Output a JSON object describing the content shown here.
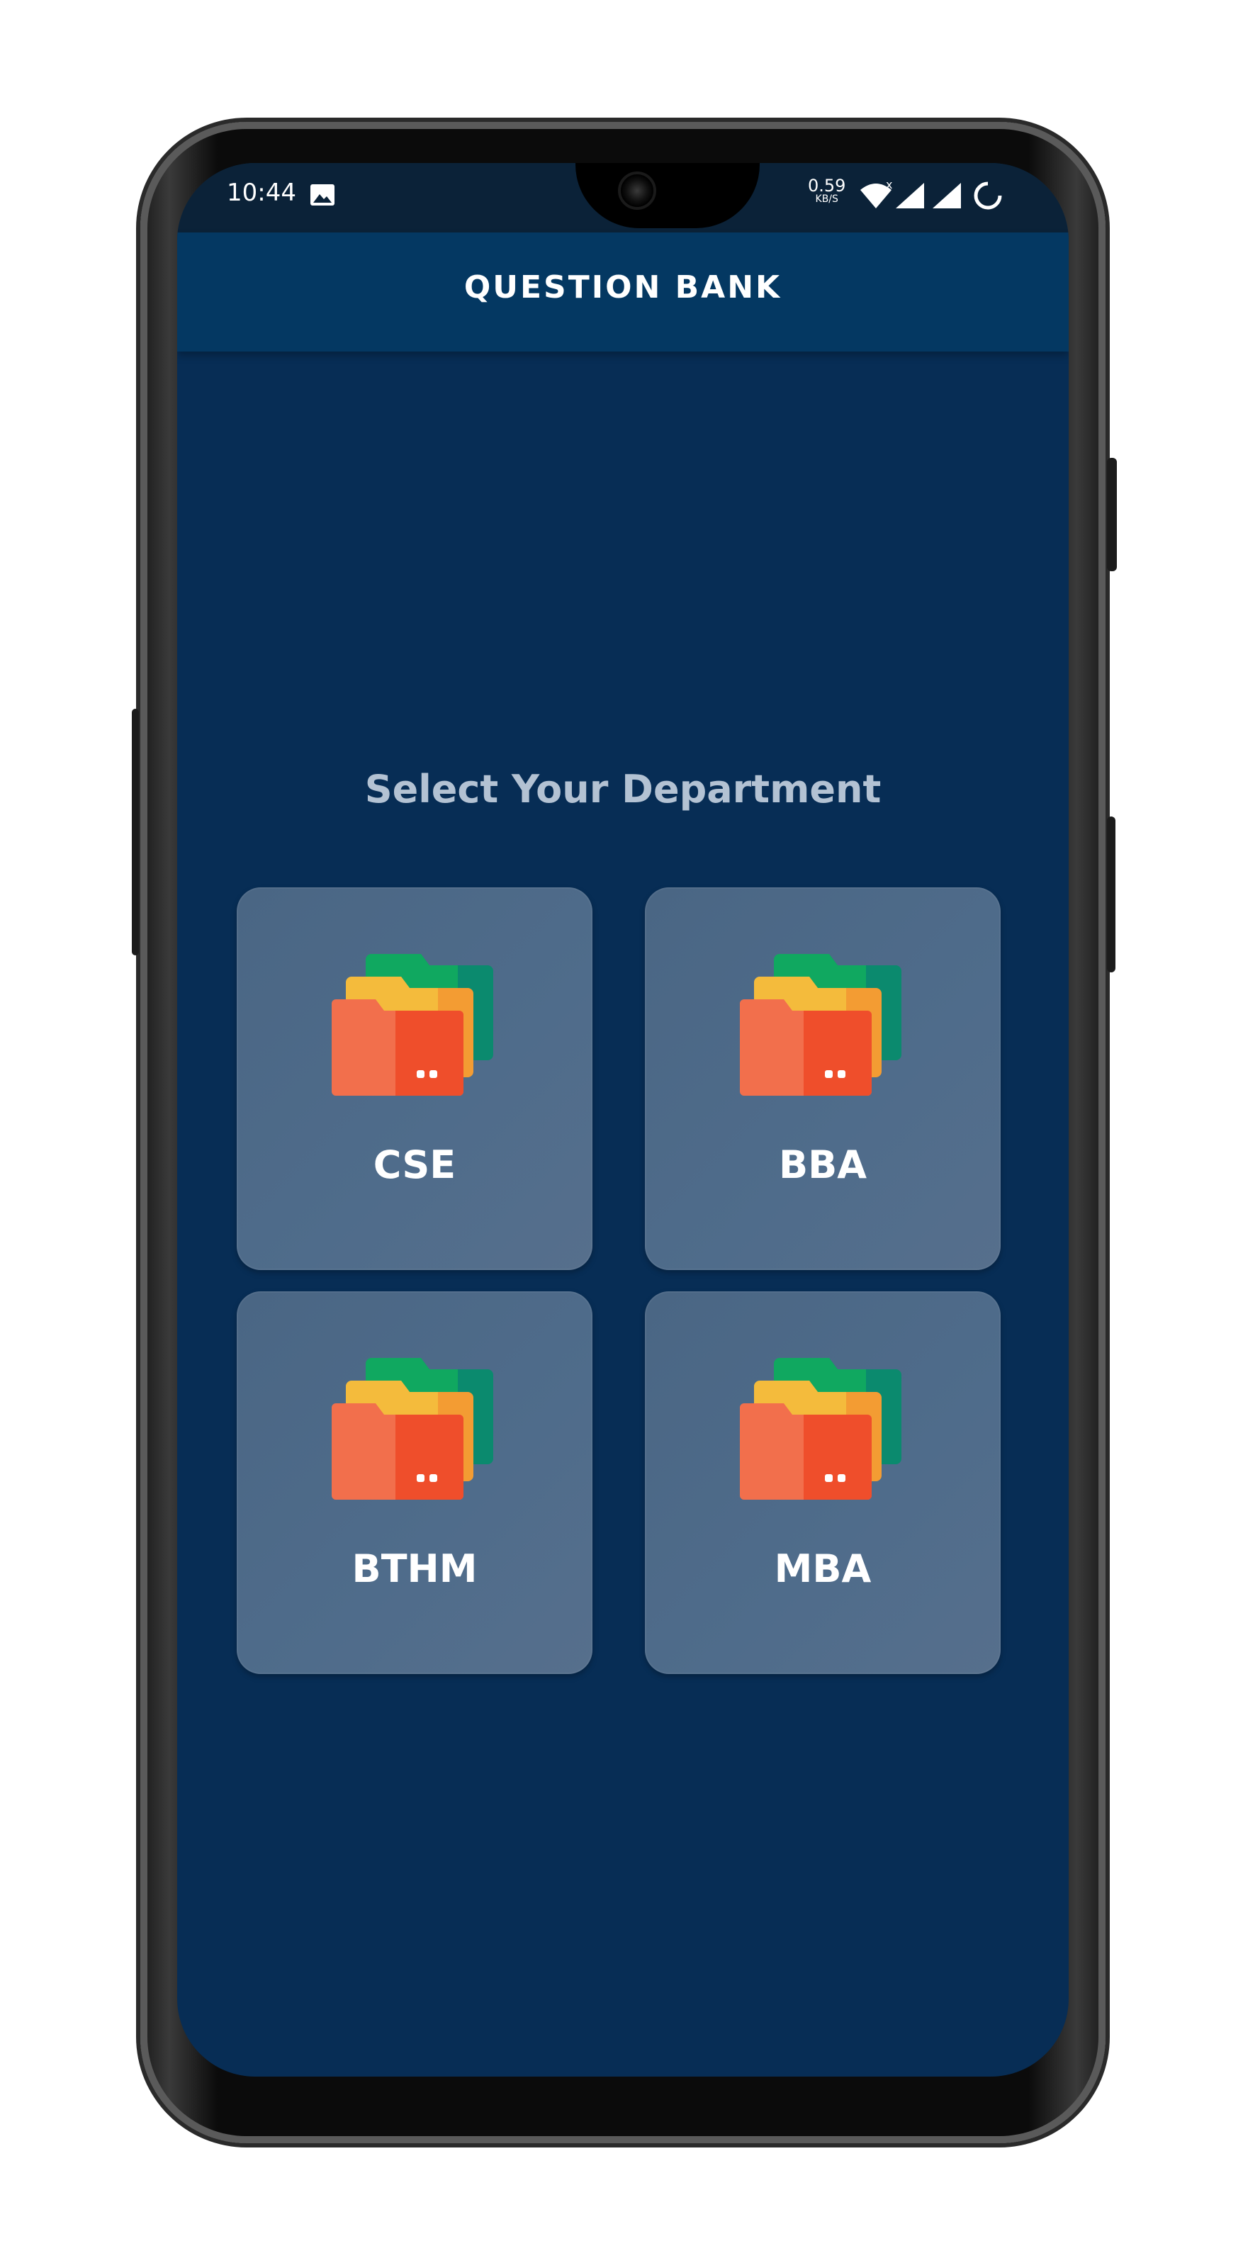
{
  "status_bar": {
    "time": "10:44",
    "speed_value": "0.59",
    "speed_unit": "KB/S",
    "icons": [
      "gallery-icon",
      "wifi-icon",
      "signal-icon",
      "signal-icon",
      "loading-ring-icon"
    ]
  },
  "app_bar": {
    "title": "QUESTION BANK"
  },
  "main": {
    "heading": "Select Your Department",
    "departments": [
      {
        "label": "CSE",
        "icon": "folders-icon"
      },
      {
        "label": "BBA",
        "icon": "folders-icon"
      },
      {
        "label": "BTHM",
        "icon": "folders-icon"
      },
      {
        "label": "MBA",
        "icon": "folders-icon"
      }
    ]
  },
  "colors": {
    "background": "#072d55",
    "app_bar": "#043862",
    "card": "#4f6c8b",
    "heading_text": "#b3c2d3"
  }
}
